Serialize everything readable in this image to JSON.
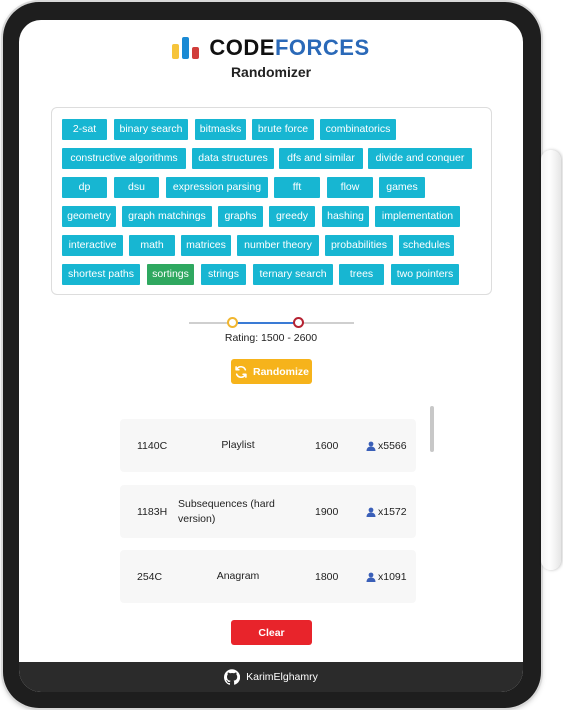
{
  "header": {
    "logo_code": "Code",
    "logo_forces": "forces",
    "subtitle": "Randomizer"
  },
  "tags": [
    {
      "label": "2-sat",
      "selected": false
    },
    {
      "label": "binary search",
      "selected": false
    },
    {
      "label": "bitmasks",
      "selected": false
    },
    {
      "label": "brute force",
      "selected": false
    },
    {
      "label": "combinatorics",
      "selected": false
    },
    {
      "label": "constructive algorithms",
      "selected": false
    },
    {
      "label": "data structures",
      "selected": false
    },
    {
      "label": "dfs and similar",
      "selected": false
    },
    {
      "label": "divide and conquer",
      "selected": false
    },
    {
      "label": "dp",
      "selected": false
    },
    {
      "label": "dsu",
      "selected": false
    },
    {
      "label": "expression parsing",
      "selected": false
    },
    {
      "label": "fft",
      "selected": false
    },
    {
      "label": "flow",
      "selected": false
    },
    {
      "label": "games",
      "selected": false
    },
    {
      "label": "geometry",
      "selected": false
    },
    {
      "label": "graph matchings",
      "selected": false
    },
    {
      "label": "graphs",
      "selected": false
    },
    {
      "label": "greedy",
      "selected": false
    },
    {
      "label": "hashing",
      "selected": false
    },
    {
      "label": "implementation",
      "selected": false
    },
    {
      "label": "interactive",
      "selected": false
    },
    {
      "label": "math",
      "selected": false
    },
    {
      "label": "matrices",
      "selected": false
    },
    {
      "label": "number theory",
      "selected": false
    },
    {
      "label": "probabilities",
      "selected": false
    },
    {
      "label": "schedules",
      "selected": false
    },
    {
      "label": "shortest paths",
      "selected": false
    },
    {
      "label": "sortings",
      "selected": true
    },
    {
      "label": "strings",
      "selected": false
    },
    {
      "label": "ternary search",
      "selected": false
    },
    {
      "label": "trees",
      "selected": false
    },
    {
      "label": "two pointers",
      "selected": false
    }
  ],
  "rating": {
    "label": "Rating: 1500 - 2600",
    "min": 1500,
    "max": 2600
  },
  "randomize_label": "Randomize",
  "problems": [
    {
      "id": "1140C",
      "name": "Playlist",
      "rating": "1600",
      "solved": "x5566"
    },
    {
      "id": "1183H",
      "name": "Subsequences (hard version)",
      "rating": "1900",
      "solved": "x1572"
    },
    {
      "id": "254C",
      "name": "Anagram",
      "rating": "1800",
      "solved": "x1091"
    }
  ],
  "clear_label": "Clear",
  "footer": {
    "username": "KarimElghamry"
  },
  "colors": {
    "tag": "#17b6d2",
    "tag_selected": "#2fa860",
    "randomize": "#f6b31b",
    "clear": "#e8242b",
    "footer": "#2b2b2b"
  }
}
